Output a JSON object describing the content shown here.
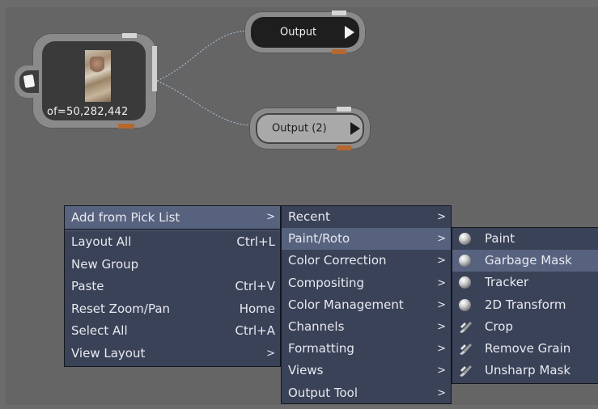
{
  "source_node": {
    "label": "of=50,282,442",
    "icon": "paper-icon"
  },
  "output_nodes": [
    {
      "label": "Output",
      "state": "active"
    },
    {
      "label": "Output (2)",
      "state": "inactive"
    }
  ],
  "context_menu": {
    "header": {
      "label": "Add from Pick List",
      "arrow": ">"
    },
    "items": [
      {
        "label": "Layout All",
        "shortcut": "Ctrl+L"
      },
      {
        "label": "New Group",
        "shortcut": ""
      },
      {
        "label": "Paste",
        "shortcut": "Ctrl+V"
      },
      {
        "label": "Reset Zoom/Pan",
        "shortcut": "Home"
      },
      {
        "label": "Select All",
        "shortcut": "Ctrl+A"
      },
      {
        "label": "View Layout",
        "arrow": ">"
      }
    ]
  },
  "category_menu": {
    "items": [
      {
        "label": "Recent",
        "arrow": ">"
      },
      {
        "label": "Paint/Roto",
        "arrow": ">",
        "highlighted": true
      },
      {
        "label": "Color Correction",
        "arrow": ">"
      },
      {
        "label": "Compositing",
        "arrow": ">"
      },
      {
        "label": "Color Management",
        "arrow": ">"
      },
      {
        "label": "Channels",
        "arrow": ">"
      },
      {
        "label": "Formatting",
        "arrow": ">"
      },
      {
        "label": "Views",
        "arrow": ">"
      },
      {
        "label": "Output Tool",
        "arrow": ">"
      }
    ]
  },
  "tool_menu": {
    "items": [
      {
        "label": "Paint",
        "icon": "sphere-icon"
      },
      {
        "label": "Garbage Mask",
        "icon": "sphere-icon",
        "highlighted": true
      },
      {
        "label": "Tracker",
        "icon": "sphere-icon"
      },
      {
        "label": "2D Transform",
        "icon": "sphere-icon"
      },
      {
        "label": "Crop",
        "icon": "brush-icon"
      },
      {
        "label": "Remove Grain",
        "icon": "brush-icon"
      },
      {
        "label": "Unsharp Mask",
        "icon": "brush-icon"
      }
    ]
  }
}
